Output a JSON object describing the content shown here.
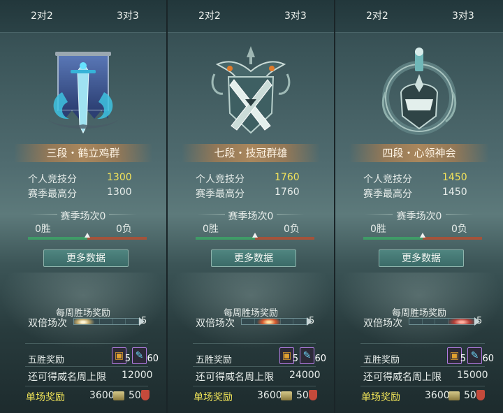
{
  "panels": [
    {
      "tab_left": "2对2",
      "tab_right": "3对3",
      "emblem_icon": "blue-banner-sword-dragon-icon",
      "rank": "三段・鹤立鸡群",
      "personal_label": "个人竞技分",
      "personal_value": "1300",
      "season_high_label": "赛季最高分",
      "season_high_value": "1300",
      "season_matches": "赛季场次0",
      "wins": "0胜",
      "losses": "0负",
      "win_ratio": 0.5,
      "more_button": "更多数据",
      "weekly_title": "每周胜场奖励",
      "double_label": "双倍场次",
      "double_count": "5",
      "double_glow": "light",
      "five_win_label": "五胜奖励",
      "item1_count": "5",
      "item2_count": "60",
      "remain_label": "还可得威名周上限",
      "remain_value": "12000",
      "single_label": "单场奖励",
      "single_coin": "3600",
      "single_honor": "50"
    },
    {
      "tab_left": "2对2",
      "tab_right": "3对3",
      "emblem_icon": "crossed-swords-crest-icon",
      "rank": "七段・技冠群雄",
      "personal_label": "个人竞技分",
      "personal_value": "1760",
      "season_high_label": "赛季最高分",
      "season_high_value": "1760",
      "season_matches": "赛季场次0",
      "wins": "0胜",
      "losses": "0负",
      "win_ratio": 0.5,
      "more_button": "更多数据",
      "weekly_title": "每周胜场奖励",
      "double_label": "双倍场次",
      "double_count": "5",
      "double_glow": "fire",
      "five_win_label": "五胜奖励",
      "item1_count": "5",
      "item2_count": "60",
      "remain_label": "还可得威名周上限",
      "remain_value": "24000",
      "single_label": "单场奖励",
      "single_coin": "3600",
      "single_honor": "50"
    },
    {
      "tab_left": "2对2",
      "tab_right": "3对3",
      "emblem_icon": "ring-sword-helmet-crest-icon",
      "rank": "四段・心领神会",
      "personal_label": "个人竞技分",
      "personal_value": "1450",
      "season_high_label": "赛季最高分",
      "season_high_value": "1450",
      "season_matches": "赛季场次0",
      "wins": "0胜",
      "losses": "0负",
      "win_ratio": 0.5,
      "more_button": "更多数据",
      "weekly_title": "每周胜场奖励",
      "double_label": "双倍场次",
      "double_count": "5",
      "double_glow": "red",
      "five_win_label": "五胜奖励",
      "item1_count": "5",
      "item2_count": "60",
      "remain_label": "还可得威名周上限",
      "remain_value": "15000",
      "single_label": "单场奖励",
      "single_coin": "3600",
      "single_honor": "50"
    }
  ],
  "colors": {
    "gold": "#f3e35a",
    "win_green": "#3f9b67",
    "loss_red": "#a4533b",
    "button": "#3b6b68"
  }
}
